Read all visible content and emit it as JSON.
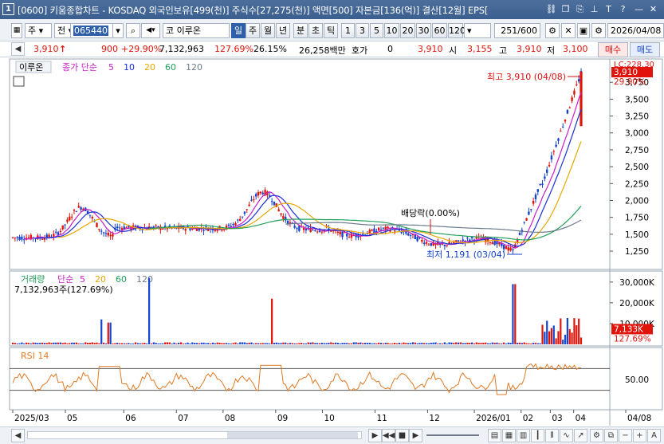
{
  "titlebar": {
    "index": "1",
    "title": "[0600] 키움종합차트 - KOSDAQ 외국인보유[499(천)] 주식수[27,275(천)] 액면[500] 자본금[136(억)] 결산[12월] EPS["
  },
  "toolbar": {
    "market": "주",
    "prev": "전",
    "code": "065440",
    "stock_prefix": "코",
    "stock_name": "이루온",
    "periods": [
      "일",
      "주",
      "월",
      "년",
      "분",
      "초",
      "틱"
    ],
    "active_period": "일",
    "intervals": [
      "1",
      "3",
      "5",
      "10",
      "20",
      "30",
      "60",
      "120"
    ],
    "count": "251",
    "count_max": "/600",
    "date": "2026/04/08"
  },
  "quote": {
    "price": "3,910",
    "change": "900",
    "change_pct": "+29.90%",
    "volume": "7,132,963",
    "volume_ratio": "127.69%",
    "turnover": "26.15%",
    "amount": "26,258백만",
    "bid_label": "호가",
    "bid_value": "0",
    "ask_value": "3,910",
    "open_label": "시",
    "open": "3,155",
    "high_label": "고",
    "high": "3,910",
    "low_label": "저",
    "low": "3,100",
    "buy_button": "매수",
    "sell_button": "매도"
  },
  "price_panel": {
    "stock_label": "이루온",
    "ma_label": "종가 단순",
    "ma_periods": [
      "5",
      "10",
      "20",
      "60",
      "120"
    ],
    "ma_colors": [
      "#c81ec8",
      "#1a2fd6",
      "#e8a800",
      "#22a05a",
      "#6b7b8c"
    ],
    "y_ticks": [
      "3,750",
      "3,500",
      "3,250",
      "3,000",
      "2,750",
      "2,500",
      "2,250",
      "2,000",
      "1,750",
      "1,500",
      "1,250"
    ],
    "last_price": "3,910",
    "last_pct": "29.90%",
    "prev_label": "LC:228.30",
    "annotation_high": "최고 3,910 (04/08)",
    "annotation_low": "최저 1,191 (03/04)",
    "annotation_dividend": "배당락(0.00%)"
  },
  "volume_panel": {
    "title": "거래량",
    "ma_label": "단순",
    "ma_periods": [
      "5",
      "20",
      "60",
      "120"
    ],
    "current": "7,132,963주(127.69%)",
    "y_ticks": [
      "30,000K",
      "20,000K",
      "10,000K"
    ],
    "last_value": "7,133K",
    "last_pct": "127.69%"
  },
  "rsi_panel": {
    "title": "RSI 14",
    "y_ticks": [
      "50.00"
    ]
  },
  "x_axis": {
    "labels": [
      "2025/03",
      "05",
      "06",
      "07",
      "08",
      "09",
      "10",
      "11",
      "12",
      "2026/01",
      "02",
      "03",
      "04",
      "04/08"
    ]
  },
  "colors": {
    "up": "#e0140a",
    "down": "#1444d0",
    "panel_border": "#9aa7b7",
    "rsi_line": "#e07a24",
    "title_bar": "#3a5f8f"
  }
}
